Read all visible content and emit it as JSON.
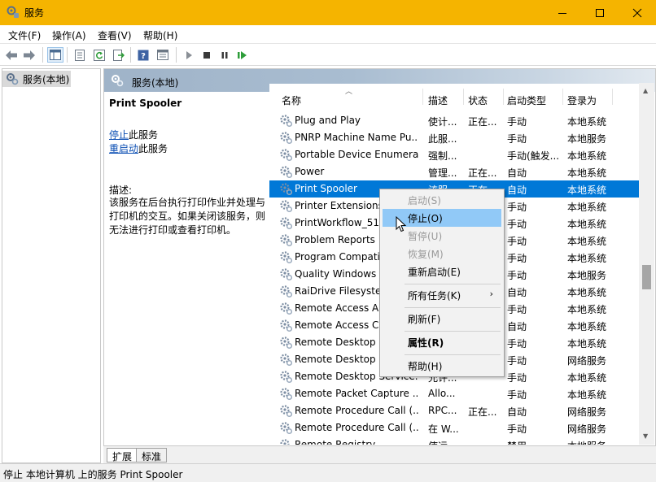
{
  "window": {
    "title": "服务",
    "title_bar_color": "#f5b400"
  },
  "menubar": {
    "items": [
      "文件(F)",
      "操作(A)",
      "查看(V)",
      "帮助(H)"
    ]
  },
  "toolbar": {
    "buttons": [
      "back-icon",
      "forward-icon",
      "show-hide-tree-icon",
      "properties-icon",
      "refresh-icon",
      "export-list-icon",
      "help-icon",
      "console-tree-icon",
      "start-service-icon",
      "stop-service-icon",
      "pause-service-icon",
      "restart-service-icon"
    ]
  },
  "tree": {
    "root_label": "服务(本地)"
  },
  "main": {
    "header": "服务(本地)",
    "detail": {
      "service_name": "Print Spooler",
      "stop_link": "停止",
      "stop_suffix": "此服务",
      "restart_link": "重启动",
      "restart_suffix": "此服务",
      "desc_label": "描述:",
      "desc_text": "该服务在后台执行打印作业并处理与打印机的交互。如果关闭该服务，则无法进行打印或查看打印机。"
    },
    "columns": [
      "名称",
      "描述",
      "状态",
      "启动类型",
      "登录为"
    ],
    "rows": [
      {
        "name": "Plug and Play",
        "desc": "使计...",
        "status": "正在...",
        "startup": "手动",
        "logon": "本地系统"
      },
      {
        "name": "PNRP Machine Name Pu...",
        "desc": "此服...",
        "status": "",
        "startup": "手动",
        "logon": "本地服务"
      },
      {
        "name": "Portable Device Enumera...",
        "desc": "强制...",
        "status": "",
        "startup": "手动(触发...",
        "logon": "本地系统"
      },
      {
        "name": "Power",
        "desc": "管理...",
        "status": "正在...",
        "startup": "自动",
        "logon": "本地系统"
      },
      {
        "name": "Print Spooler",
        "desc": "该服...",
        "status": "正在...",
        "startup": "自动",
        "logon": "本地系统"
      },
      {
        "name": "Printer Extensions",
        "desc": "",
        "status": "",
        "startup": "手动",
        "logon": "本地系统"
      },
      {
        "name": "PrintWorkflow_517",
        "desc": "",
        "status": "",
        "startup": "手动",
        "logon": "本地系统"
      },
      {
        "name": "Problem Reports",
        "desc": "",
        "status": "",
        "startup": "手动",
        "logon": "本地系统"
      },
      {
        "name": "Program Compatib",
        "desc": "",
        "status": "",
        "startup": "手动",
        "logon": "本地系统"
      },
      {
        "name": "Quality Windows A",
        "desc": "",
        "status": "",
        "startup": "手动",
        "logon": "本地服务"
      },
      {
        "name": "RaiDrive Filesyster",
        "desc": "",
        "status": "",
        "startup": "自动",
        "logon": "本地系统"
      },
      {
        "name": "Remote Access Au",
        "desc": "",
        "status": "",
        "startup": "手动",
        "logon": "本地系统"
      },
      {
        "name": "Remote Access Co",
        "desc": "",
        "status": "",
        "startup": "自动",
        "logon": "本地系统"
      },
      {
        "name": "Remote Desktop C",
        "desc": "",
        "status": "",
        "startup": "手动",
        "logon": "本地系统"
      },
      {
        "name": "Remote Desktop S",
        "desc": "",
        "status": "",
        "startup": "手动",
        "logon": "网络服务"
      },
      {
        "name": "Remote Desktop Service...",
        "desc": "允许...",
        "status": "",
        "startup": "手动",
        "logon": "本地系统"
      },
      {
        "name": "Remote Packet Capture ...",
        "desc": "Allo...",
        "status": "",
        "startup": "手动",
        "logon": "本地系统"
      },
      {
        "name": "Remote Procedure Call (...",
        "desc": "RPC...",
        "status": "正在...",
        "startup": "自动",
        "logon": "网络服务"
      },
      {
        "name": "Remote Procedure Call (...",
        "desc": "在 W...",
        "status": "",
        "startup": "手动",
        "logon": "网络服务"
      },
      {
        "name": "Remote Registry",
        "desc": "使远...",
        "status": "",
        "startup": "禁用",
        "logon": "本地服务"
      }
    ],
    "selected_row": 4
  },
  "context_menu": {
    "items": [
      {
        "label": "启动(S)",
        "state": "disabled"
      },
      {
        "label": "停止(O)",
        "state": "hover"
      },
      {
        "label": "暂停(U)",
        "state": "disabled"
      },
      {
        "label": "恢复(M)",
        "state": "disabled"
      },
      {
        "label": "重新启动(E)",
        "state": "normal"
      },
      {
        "label": "所有任务(K)",
        "state": "submenu"
      },
      {
        "label": "刷新(F)",
        "state": "normal"
      },
      {
        "label": "属性(R)",
        "state": "bold"
      },
      {
        "label": "帮助(H)",
        "state": "normal"
      }
    ]
  },
  "tabs": [
    "扩展",
    "标准"
  ],
  "status_bar": {
    "text": "停止 本地计算机 上的服务 Print Spooler"
  },
  "colors": {
    "selection": "#0078d7",
    "link": "#0b4eb3",
    "menu_hover": "#91c9f7"
  }
}
